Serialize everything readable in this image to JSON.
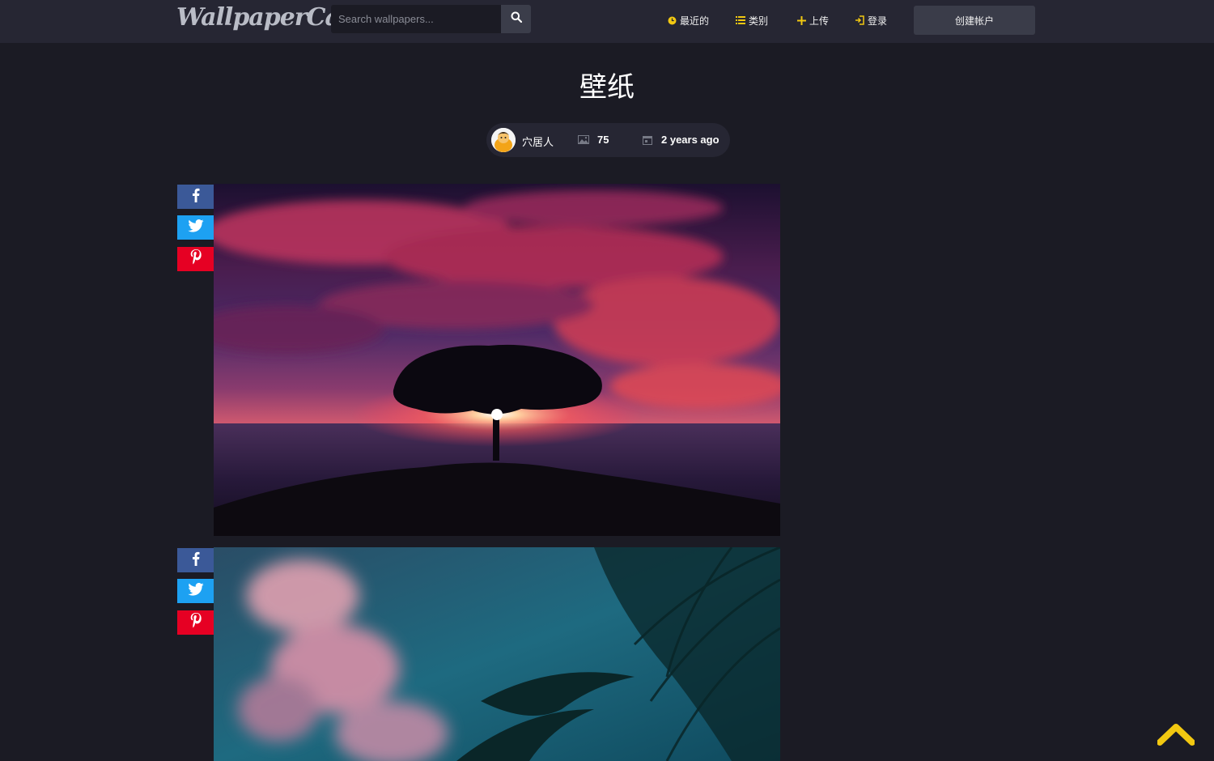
{
  "header": {
    "logo": "WallpaperCave",
    "search_placeholder": "Search wallpapers...",
    "nav": [
      {
        "label": "最近的",
        "icon": "clock-icon"
      },
      {
        "label": "类别",
        "icon": "list-icon"
      },
      {
        "label": "上传",
        "icon": "plus-icon"
      },
      {
        "label": "登录",
        "icon": "sign-in-icon"
      }
    ],
    "create_account": "创建帐户"
  },
  "page": {
    "title": "壁纸",
    "meta": {
      "author": "穴居人",
      "count": "75",
      "time": "2 years ago"
    }
  },
  "share_icons": [
    "facebook-icon",
    "twitter-icon",
    "pinterest-icon"
  ],
  "colors": {
    "background": "#1b1b24",
    "header": "#262633",
    "accent_yellow": "#f2c811",
    "facebook": "#3b5998",
    "twitter": "#1da1f2",
    "pinterest": "#e60023"
  },
  "wallpapers": [
    {
      "subject": "tree-sunset-sea"
    },
    {
      "subject": "palm-cloud-teal"
    }
  ]
}
